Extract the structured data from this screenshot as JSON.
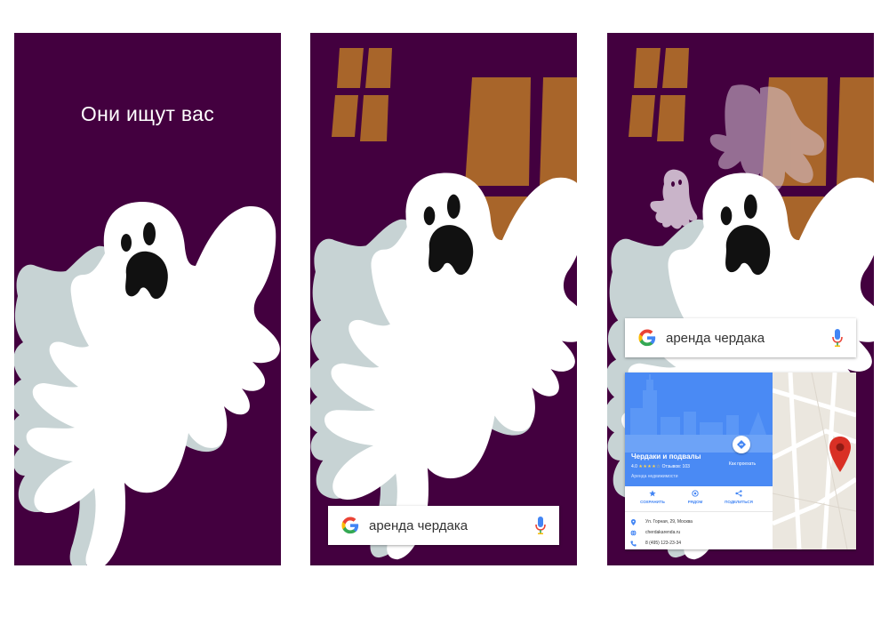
{
  "panel1": {
    "caption": "Они ищут вас"
  },
  "search": {
    "query": "аренда чердака",
    "logo_icon": "google-g-icon",
    "mic_icon": "microphone-icon"
  },
  "place_card": {
    "name": "Чердаки и подвалы",
    "rating": "4.0",
    "stars": "★★★★☆",
    "reviews": "Отзывов: 103",
    "category": "Аренда недвижимости",
    "directions_label": "Как проехать",
    "actions": [
      {
        "label": "СОХРАНИТЬ",
        "icon": "star-icon"
      },
      {
        "label": "РЯДОМ",
        "icon": "nearby-icon"
      },
      {
        "label": "ПОДЕЛИТЬСЯ",
        "icon": "share-icon"
      }
    ],
    "address": "Ул. Горная, 29, Москва",
    "website": "cherdakarenda.ru",
    "phone": "8 (495) 123-23-34"
  },
  "colors": {
    "background": "#43003f",
    "window": "#a8652a",
    "ghost_white": "#ffffff",
    "ghost_shadow": "#c7d3d4",
    "card_blue": "#4a8af4",
    "map_pin": "#d93025"
  }
}
